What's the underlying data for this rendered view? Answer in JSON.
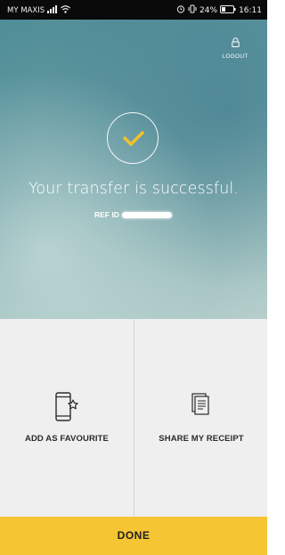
{
  "status_bar": {
    "carrier": "MY MAXIS",
    "battery": "24%",
    "time": "16:11"
  },
  "header": {
    "logout_label": "LOGOUT"
  },
  "result": {
    "title": "Your transfer is successful.",
    "ref_label": "REF ID"
  },
  "actions": [
    {
      "label": "ADD AS FAVOURITE",
      "icon": "phone-star-icon"
    },
    {
      "label": "SHARE MY RECEIPT",
      "icon": "receipt-icon"
    }
  ],
  "footer": {
    "done_label": "DONE"
  },
  "colors": {
    "accent": "#f5c534",
    "check": "#f2c12e",
    "hero_teal": "#6a9ea4"
  }
}
